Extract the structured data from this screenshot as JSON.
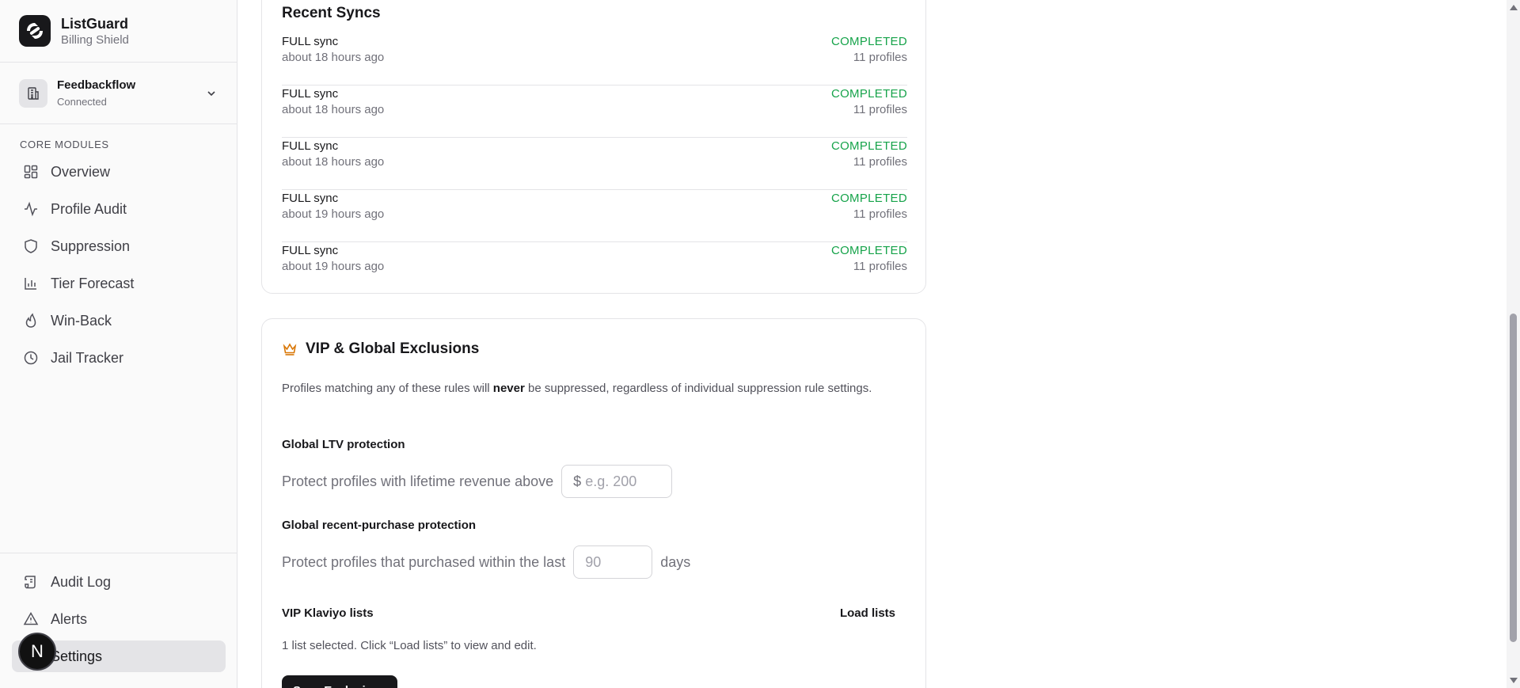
{
  "brand": {
    "name": "ListGuard",
    "subtitle": "Billing Shield"
  },
  "workspace": {
    "name": "Feedbackflow",
    "status": "Connected"
  },
  "sidebar": {
    "section_label": "CORE MODULES",
    "items": [
      {
        "label": "Overview",
        "icon": "grid-icon"
      },
      {
        "label": "Profile Audit",
        "icon": "activity-icon"
      },
      {
        "label": "Suppression",
        "icon": "shield-icon"
      },
      {
        "label": "Tier Forecast",
        "icon": "bar-chart-icon"
      },
      {
        "label": "Win-Back",
        "icon": "flame-icon"
      },
      {
        "label": "Jail Tracker",
        "icon": "clock-icon"
      }
    ],
    "bottom_items": [
      {
        "label": "Audit Log",
        "icon": "scroll-icon"
      },
      {
        "label": "Alerts",
        "icon": "alert-triangle-icon"
      },
      {
        "label": "Settings",
        "icon": "settings-icon",
        "active": true
      }
    ]
  },
  "avatar": {
    "initial": "N"
  },
  "recent_syncs": {
    "title": "Recent Syncs",
    "rows": [
      {
        "type": "FULL sync",
        "time": "about 18 hours ago",
        "status": "COMPLETED",
        "count": "11 profiles"
      },
      {
        "type": "FULL sync",
        "time": "about 18 hours ago",
        "status": "COMPLETED",
        "count": "11 profiles"
      },
      {
        "type": "FULL sync",
        "time": "about 18 hours ago",
        "status": "COMPLETED",
        "count": "11 profiles"
      },
      {
        "type": "FULL sync",
        "time": "about 19 hours ago",
        "status": "COMPLETED",
        "count": "11 profiles"
      },
      {
        "type": "FULL sync",
        "time": "about 19 hours ago",
        "status": "COMPLETED",
        "count": "11 profiles"
      }
    ],
    "status_color": "#16a34a"
  },
  "exclusions": {
    "title": "VIP & Global Exclusions",
    "desc_before": "Profiles matching any of these rules will ",
    "desc_bold": "never",
    "desc_after": " be suppressed, regardless of individual suppression rule settings.",
    "ltv": {
      "label": "Global LTV protection",
      "text": "Protect profiles with lifetime revenue above",
      "prefix": "$",
      "placeholder": "e.g. 200",
      "value": ""
    },
    "recent": {
      "label": "Global recent-purchase protection",
      "text": "Protect profiles that purchased within the last",
      "placeholder": "90",
      "value": "",
      "suffix": "days"
    },
    "vip": {
      "label": "VIP Klaviyo lists",
      "load_label": "Load lists",
      "note": "1 list selected. Click “Load lists” to view and edit."
    },
    "save_label": "Save Exclusions",
    "accent_color": "#d97706"
  }
}
